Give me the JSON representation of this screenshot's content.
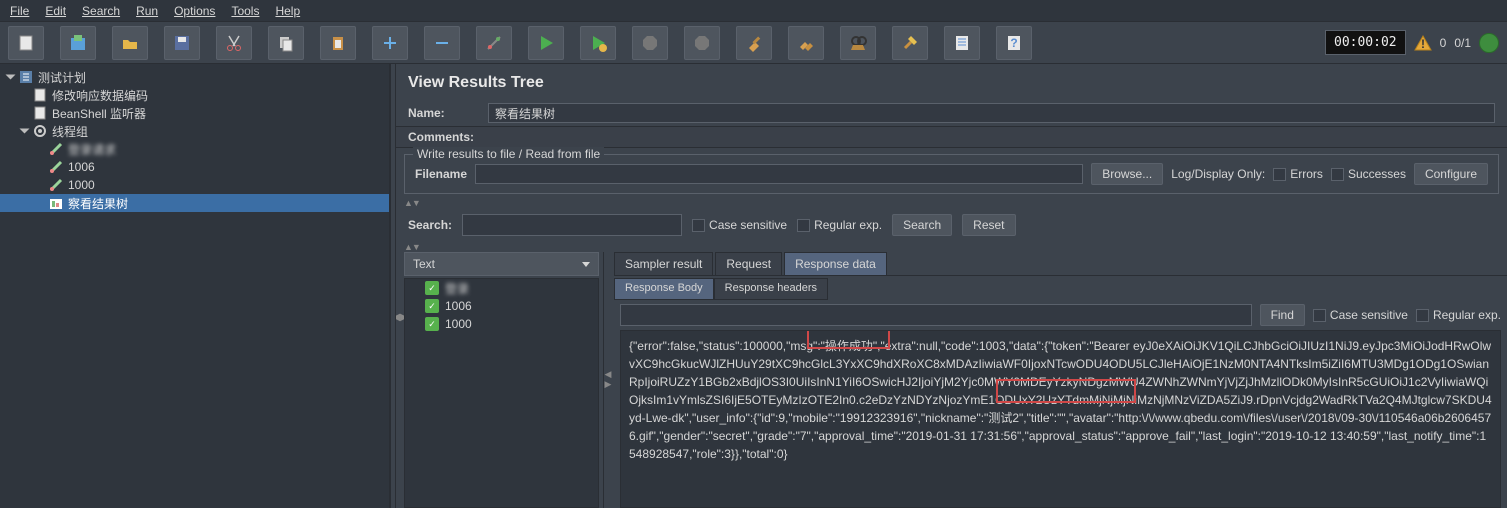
{
  "menu": {
    "file": "File",
    "edit": "Edit",
    "search": "Search",
    "run": "Run",
    "options": "Options",
    "tools": "Tools",
    "help": "Help"
  },
  "toolbar": {
    "timer": "00:00:02",
    "warn_count": "0",
    "thread_status": "0/1"
  },
  "tree": {
    "root": "测试计划",
    "n1": "修改响应数据编码",
    "n2": "BeanShell 监听器",
    "tg": "线程组",
    "s1": "登录请求",
    "s2": "1006",
    "s3": "1000",
    "vrt": "察看结果树"
  },
  "panel": {
    "title": "View Results Tree",
    "name_lbl": "Name:",
    "name_val": "察看结果树",
    "comments_lbl": "Comments:",
    "fieldset_legend": "Write results to file / Read from file",
    "filename_lbl": "Filename",
    "browse_btn": "Browse...",
    "logdisplay_lbl": "Log/Display Only:",
    "errors_lbl": "Errors",
    "successes_lbl": "Successes",
    "configure_btn": "Configure",
    "search_lbl": "Search:",
    "case_lbl": "Case sensitive",
    "regex_lbl": "Regular exp.",
    "search_btn": "Search",
    "reset_btn": "Reset",
    "renderer": "Text",
    "tab_sampler": "Sampler result",
    "tab_request": "Request",
    "tab_response": "Response data",
    "subtab_body": "Response Body",
    "subtab_headers": "Response headers",
    "find_btn": "Find",
    "find_case": "Case sensitive",
    "find_regex": "Regular exp."
  },
  "samplers": {
    "s1": "登录",
    "s2": "1006",
    "s3": "1000"
  },
  "response_text": "{\"error\":false,\"status\":100000,\"msg\":\"操作成功\",\"extra\":null,\"code\":1003,\"data\":{\"token\":\"Bearer eyJ0eXAiOiJKV1QiLCJhbGciOiJIUzI1NiJ9.eyJpc3MiOiJodHRwOlwvXC9hcGkucWJlZHUuY29tXC9hcGlcL3YxXC9hdXRoXC8xMDAzIiwiaWF0IjoxNTcwODU4ODU5LCJleHAiOjE1NzM0NTA4NTksIm5iZiI6MTU3MDg1ODg1OSwianRpIjoiRUZzY1BGb2xBdjlOS3I0UiIsInN1YiI6OSwicHJ2IjoiYjM2Yjc0MWY0MDEyYzkyNDgzMWU4ZWNhZWNmYjVjZjJhMzllODk0MyIsInR5cGUiOiJ1c2VyIiwiaWQiOjksIm1vYmlsZSI6IjE5OTEyMzIzOTE2In0.c2eDzYzNDYzNjozYmE1ODUxY2UzYTdmMjNjMjNiMzNjMNzViZDA5ZiJ9.rDpnVcjdg2WadRkTVa2Q4MJtglcw7SKDU4yd-Lwe-dk\",\"user_info\":{\"id\":9,\"mobile\":\"19912323916\",\"nickname\":\"测试2\",\"title\":\"\",\"avatar\":\"http:\\/\\/www.qbedu.com\\/files\\/user\\/2018\\/09-30\\/110546a06b26064576.gif\",\"gender\":\"secret\",\"grade\":\"7\",\"approval_time\":\"2019-01-31 17:31:56\",\"approval_status\":\"approve_fail\",\"last_login\":\"2019-10-12 13:40:59\",\"last_notify_time\":1548928547,\"role\":3}},\"total\":0}"
}
